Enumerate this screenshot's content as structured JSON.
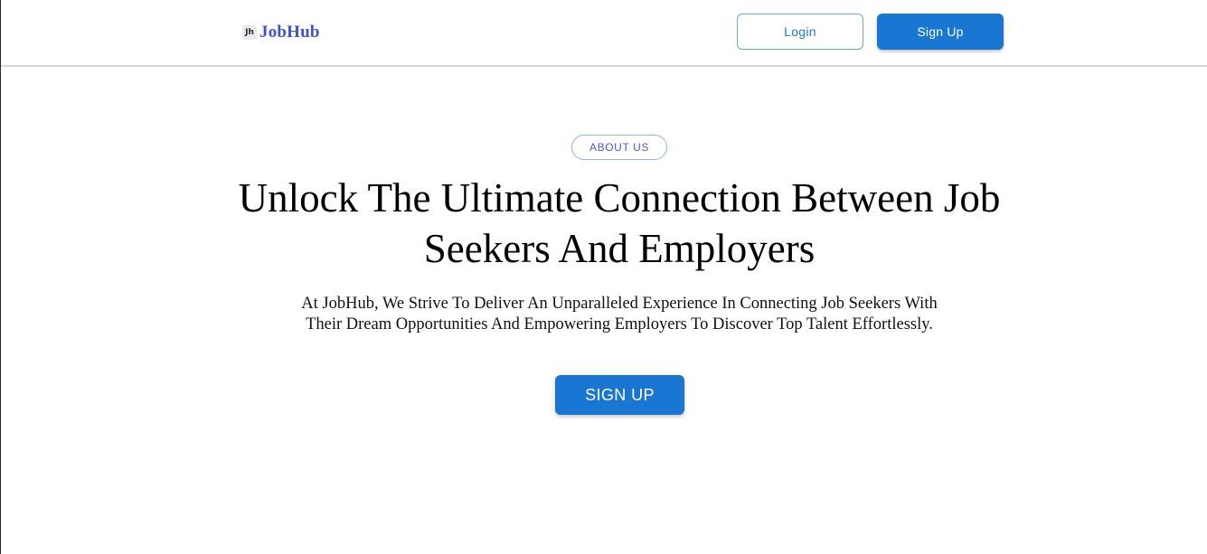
{
  "navbar": {
    "brand": {
      "icon": "jh-logo-icon",
      "icon_text": "Jh",
      "name": "JobHub",
      "color": "#3f4fd6"
    },
    "login_label": "Login",
    "signup_label": "Sign Up"
  },
  "hero": {
    "badge": "ABOUT US",
    "title_line1": "Unlock The Ultimate Connection Between Job",
    "title_line2": "Seekers And Employers",
    "description_line1": "At JobHub, We Strive To Deliver An Unparalleled Experience In Connecting Job Seekers With",
    "description_line2": "Their Dream Opportunities And Empowering Employers To Discover Top Talent Effortlessly.",
    "cta_label": "SIGN UP"
  },
  "colors": {
    "primary": "#1976d2",
    "brand_text": "#3f4fd6",
    "outline": "#6ea3e2"
  }
}
